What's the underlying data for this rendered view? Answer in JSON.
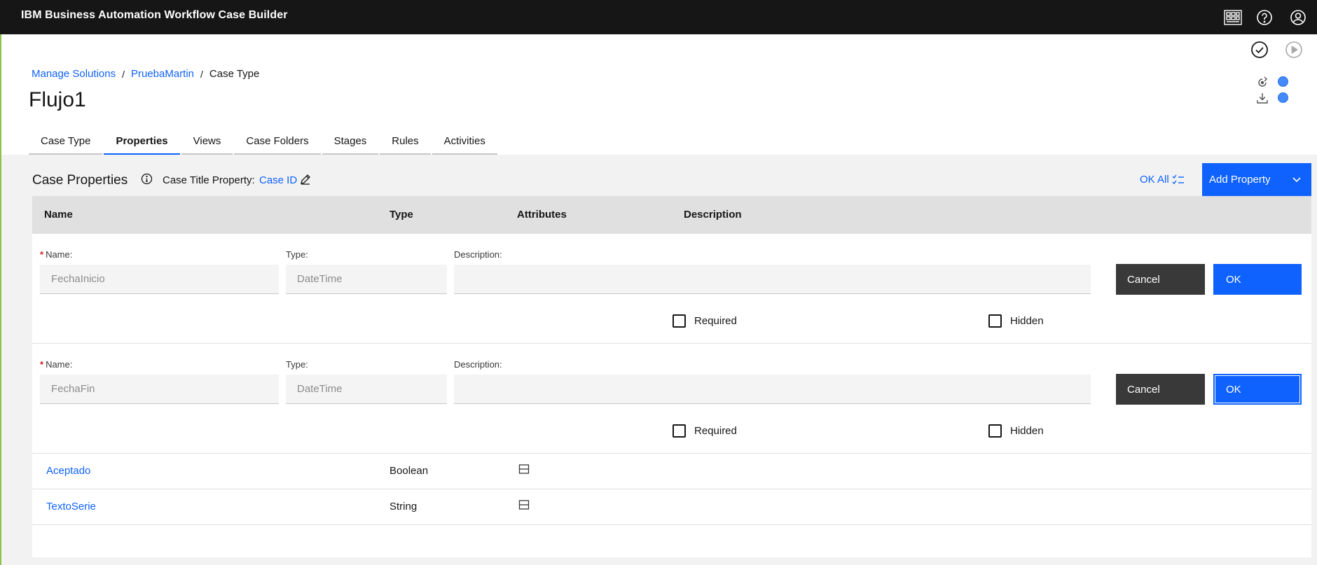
{
  "app": {
    "title": "IBM Business Automation Workflow Case Builder"
  },
  "topbar_icons": [
    "apps-grid-icon",
    "help-icon",
    "user-avatar-icon"
  ],
  "header_icons": [
    "validate-check-icon",
    "run-play-icon",
    "deploy-icon",
    "download-icon"
  ],
  "breadcrumb": {
    "items": [
      "Manage Solutions",
      "PruebaMartin"
    ],
    "separator": "/",
    "current": "Case Type"
  },
  "page": {
    "title": "Flujo1"
  },
  "tabs": [
    {
      "label": "Case Type",
      "active": false
    },
    {
      "label": "Properties",
      "active": true
    },
    {
      "label": "Views",
      "active": false
    },
    {
      "label": "Case Folders",
      "active": false
    },
    {
      "label": "Stages",
      "active": false
    },
    {
      "label": "Rules",
      "active": false
    },
    {
      "label": "Activities",
      "active": false
    }
  ],
  "case_properties": {
    "title": "Case Properties",
    "title_property_label": "Case Title Property:",
    "title_property_value": "Case ID",
    "ok_all_label": "OK All",
    "add_property_label": "Add Property"
  },
  "table": {
    "headers": {
      "name": "Name",
      "type": "Type",
      "attributes": "Attributes",
      "description": "Description"
    },
    "edit_rows": [
      {
        "required_star": "*",
        "name_label": "Name:",
        "name_value": "FechaInicio",
        "type_label": "Type:",
        "type_value": "DateTime",
        "description_label": "Description:",
        "description_value": "",
        "cancel_label": "Cancel",
        "ok_label": "OK",
        "required_label": "Required",
        "hidden_label": "Hidden"
      },
      {
        "required_star": "*",
        "name_label": "Name:",
        "name_value": "FechaFin",
        "type_label": "Type:",
        "type_value": "DateTime",
        "description_label": "Description:",
        "description_value": "",
        "cancel_label": "Cancel",
        "ok_label": "OK",
        "required_label": "Required",
        "hidden_label": "Hidden"
      }
    ],
    "rows": [
      {
        "name": "Aceptado",
        "type": "Boolean",
        "attribute_icon": "property-attribute-icon"
      },
      {
        "name": "TextoSerie",
        "type": "String",
        "attribute_icon": "property-attribute-icon"
      }
    ]
  },
  "colors": {
    "topbar": "#161616",
    "accent": "#0f62fe",
    "secondary_button": "#393939",
    "required_star": "#da1e28",
    "status_dot": "#4589ff"
  }
}
